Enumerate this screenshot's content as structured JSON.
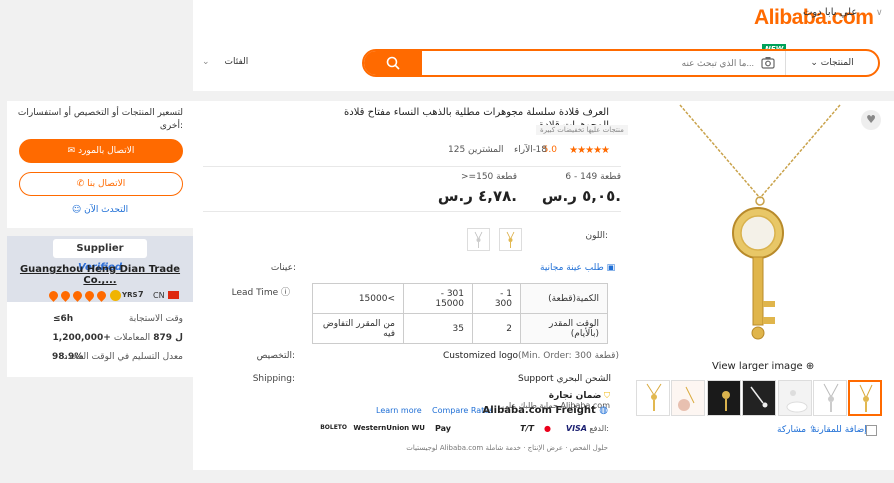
{
  "header": {
    "logo": "Alibaba.com",
    "logo_subtitle": "علي بابا دوت",
    "search_placeholder": "ما الذي تبحث عنه...",
    "search_category": "المنتجات",
    "new_badge": "NEW",
    "categories_label": "الفئات"
  },
  "contact": {
    "note": "لتسعير المنتجات أو التخصيص أو استفسارات أخرى:",
    "contact_now": "الاتصال بالمورد",
    "call_us": "الاتصال بنا",
    "chat_now": "التحدث الآن"
  },
  "supplier": {
    "tag_supplier": "Supplier",
    "tag_verified": "Verified",
    "name": "Guangzhou Heng Dian Trade Co.,...",
    "years": "7",
    "years_label": "YRS",
    "country": "CN",
    "stats": [
      {
        "label": "وقت الاستجابة",
        "value": "≤6h"
      },
      {
        "label": "المعاملات",
        "value": "1,200,000+ ل 879"
      },
      {
        "label": "معدل التسليم في الوقت المحدد",
        "value": "98.9%"
      }
    ]
  },
  "product": {
    "title": "العرف قلادة سلسلة مجوهرات مطلية بالذهب النساء مفتاح قلادة المجوهرات قلادة",
    "discount_tag": "منتجات عليها تخفيضات كبيرة",
    "rating": "5.0",
    "reviews": "18",
    "reviews_label": "الآراء",
    "buyers": "125 المشترين",
    "stars_filled": 5,
    "prices": [
      {
        "qty": "6 - 149 قطعة",
        "price": "٥,٠٥ ر.س."
      },
      {
        "qty": ">=150 قطعة",
        "price": "٤,٧٨ ر.س."
      }
    ],
    "color_label": "اللون:",
    "samples_label": "عينات:",
    "free_sample": "طلب عينة مجانية",
    "lead_time_label": "Lead Time",
    "lead_table": {
      "row1": [
        "الكمية(قطعة)",
        "1 - 300",
        "301 - 15000",
        ">15000"
      ],
      "row2": [
        "الوقت المقدر (بالأيام)",
        "2",
        "35",
        "من المقرر التفاوض فيه"
      ]
    },
    "customization_label": "التخصيص:",
    "customized_logo": "Customized logo",
    "min_order": "(Min. Order: 300 قطعة)",
    "shipping_label": "Shipping:",
    "support": "Support الشحن البحري",
    "trade_assurance": "ضمان تجارة",
    "trade_assurance_note": "حماية طلبك على Alibaba.com",
    "freight": "Alibaba.com Freight",
    "compare_rates": "Compare Rates",
    "learn_more": "Learn more",
    "payments_label": "الدفع:",
    "payments": [
      "VISA",
      "MC",
      "T/T",
      "Pay",
      "WesternUnion WU",
      "BOLETO"
    ],
    "footer_services": "لوجيستيات Alibaba.com حلول الفحص · عرض الإنتاج · خدمة شاملة"
  },
  "gallery": {
    "view_larger": "View larger image",
    "compare": "إضافة للمقارنة",
    "share": "مشاركة",
    "thumbs": 7
  },
  "colors": {
    "accent": "#ff6a00",
    "link": "#1f6fd6"
  }
}
